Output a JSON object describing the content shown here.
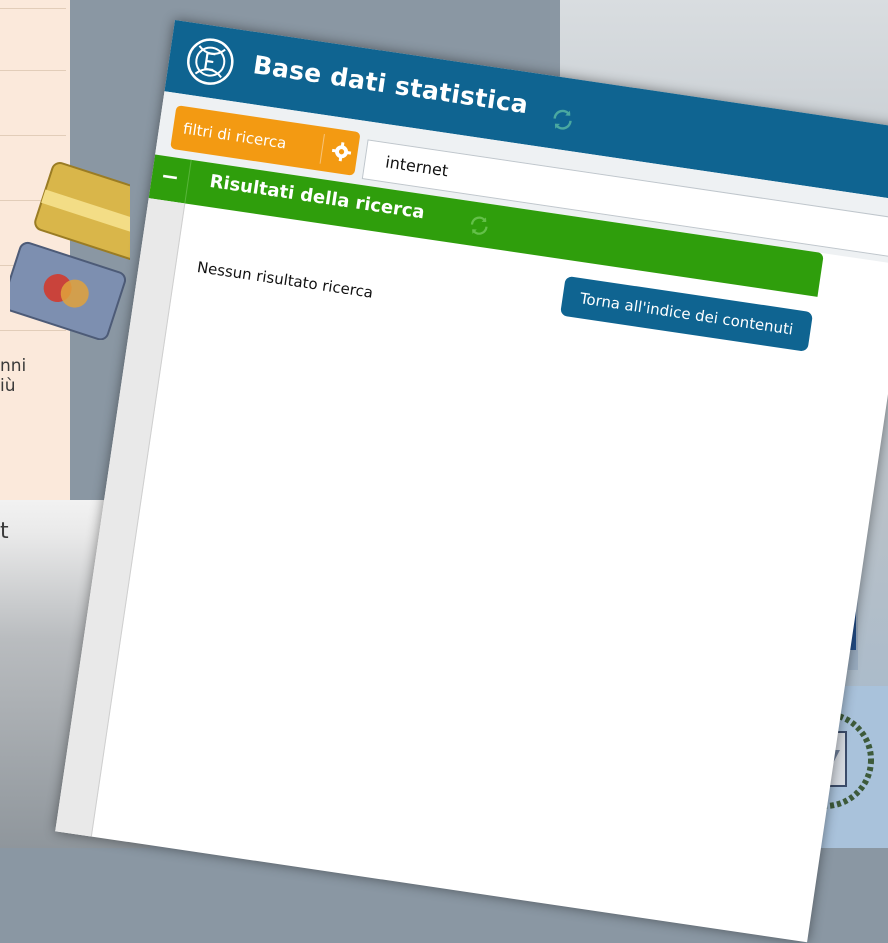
{
  "background": {
    "left_text_line1": "nni",
    "left_text_line2": "iù",
    "left_text_line3": "t"
  },
  "app": {
    "title": "Base dati statistica"
  },
  "toolbar": {
    "filters_label": "filtri di ricerca",
    "search_value": "internet"
  },
  "results": {
    "header_title": "Risultati della ricerca",
    "collapse_symbol": "−",
    "empty_message": "Nessun risultato ricerca",
    "back_button_label": "Torna all'indice dei contenuti"
  },
  "colors": {
    "titlebar": "#0f6491",
    "filters_button": "#f39a12",
    "results_bar": "#2f9e0c"
  },
  "icons": [
    "crest-logo-icon",
    "refresh-icon",
    "gear-icon",
    "collapse-icon"
  ]
}
